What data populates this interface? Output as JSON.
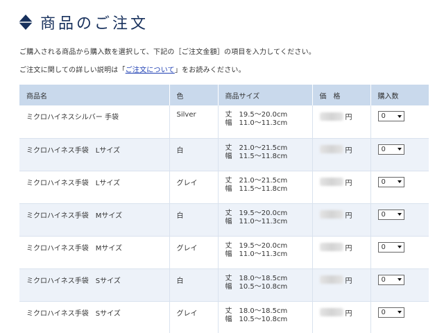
{
  "page": {
    "title": "商品のご注文",
    "intro_line1": "ご購入される商品から購入数を選択して、下記の［ご注文金額］の項目を入力してください。",
    "intro_line2_before": "ご注文に関しての詳しい説明は「",
    "intro_line2_link": "ご注文について",
    "intro_line2_after": "」をお読みください。"
  },
  "colors": {
    "title": "#17305c",
    "header_bg": "#c9d9ec",
    "alt_row_bg": "#edf2f9",
    "link": "#1e3fb3"
  },
  "table": {
    "headers": {
      "name": "商品名",
      "color": "色",
      "size": "商品サイズ",
      "price": "価　格",
      "qty": "購入数"
    },
    "price_unit": "円",
    "qty_default": "0",
    "rows": [
      {
        "name": "ミクロハイネスシルバー 手袋",
        "color": "Silver",
        "len": "丈　19.5～20.0cm",
        "width": "幅　11.0～11.3cm"
      },
      {
        "name": "ミクロハイネス手袋　Lサイズ",
        "color": "白",
        "len": "丈　21.0～21.5cm",
        "width": "幅　11.5～11.8cm"
      },
      {
        "name": "ミクロハイネス手袋　Lサイズ",
        "color": "グレイ",
        "len": "丈　21.0～21.5cm",
        "width": "幅　11.5～11.8cm"
      },
      {
        "name": "ミクロハイネス手袋　Mサイズ",
        "color": "白",
        "len": "丈　19.5～20.0cm",
        "width": "幅　11.0～11.3cm"
      },
      {
        "name": "ミクロハイネス手袋　Mサイズ",
        "color": "グレイ",
        "len": "丈　19.5～20.0cm",
        "width": "幅　11.0～11.3cm"
      },
      {
        "name": "ミクロハイネス手袋　Sサイズ",
        "color": "白",
        "len": "丈　18.0～18.5cm",
        "width": "幅　10.5～10.8cm"
      },
      {
        "name": "ミクロハイネス手袋　Sサイズ",
        "color": "グレイ",
        "len": "丈　18.0～18.5cm",
        "width": "幅　10.5～10.8cm"
      }
    ]
  }
}
